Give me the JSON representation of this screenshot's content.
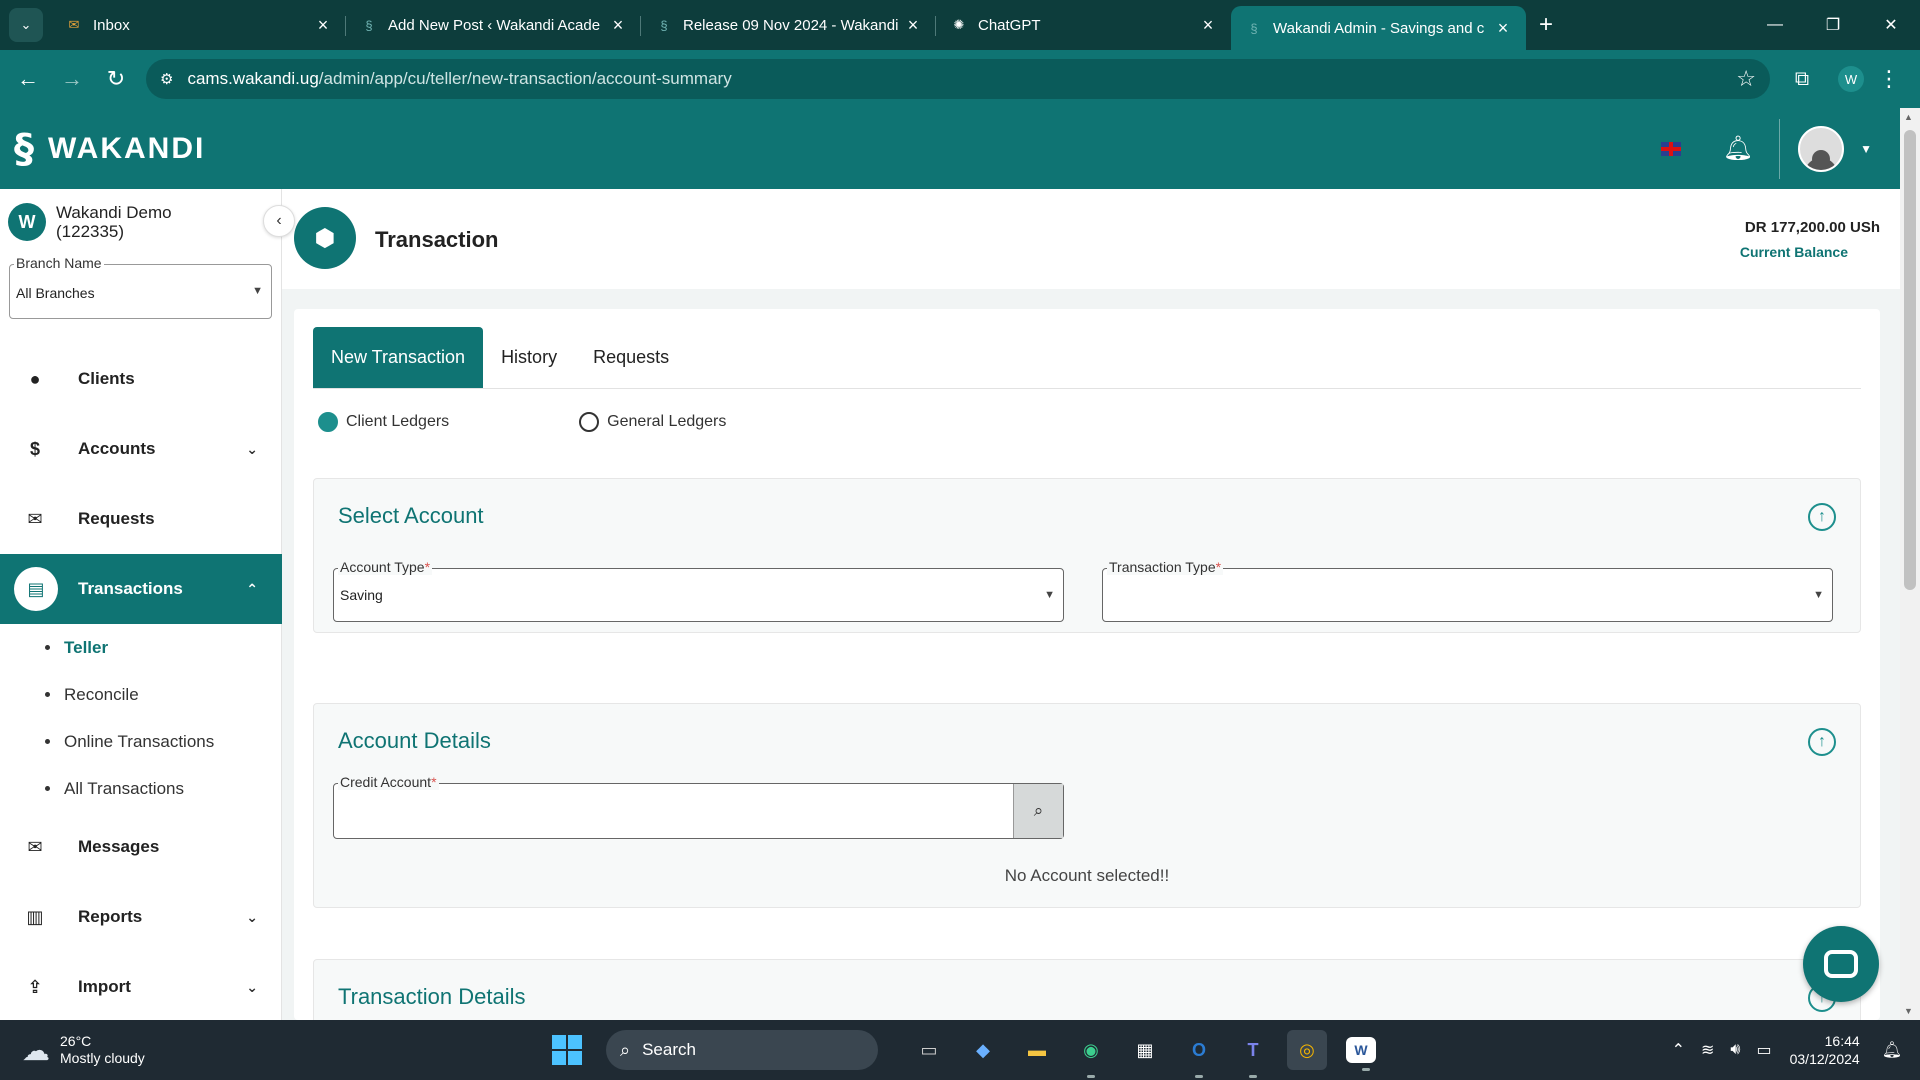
{
  "browser": {
    "tabs": [
      {
        "title": "Inbox",
        "icon": "mail-icon"
      },
      {
        "title": "Add New Post ‹ Wakandi Acade",
        "icon": "wakandi-icon"
      },
      {
        "title": "Release 09 Nov 2024 - Wakandi",
        "icon": "wakandi-icon"
      },
      {
        "title": "ChatGPT",
        "icon": "chatgpt-icon"
      },
      {
        "title": "Wakandi Admin - Savings and c",
        "icon": "wakandi-icon"
      }
    ],
    "url_domain": "cams.wakandi.ug",
    "url_path": "/admin/app/cu/teller/new-transaction/account-summary",
    "profile_initial": "W"
  },
  "header": {
    "logo_text": "WAKANDI"
  },
  "sidebar": {
    "org_initial": "W",
    "org_name": "Wakandi Demo",
    "org_id": "(122335)",
    "branch_label": "Branch Name",
    "branch_value": "All Branches",
    "menu": [
      {
        "label": "Clients",
        "icon": "person-icon"
      },
      {
        "label": "Accounts",
        "icon": "money-bag-icon"
      },
      {
        "label": "Requests",
        "icon": "envelope-icon"
      },
      {
        "label": "Transactions",
        "icon": "book-icon"
      },
      {
        "label": "Messages",
        "icon": "envelope-icon"
      },
      {
        "label": "Reports",
        "icon": "bar-chart-icon"
      },
      {
        "label": "Import",
        "icon": "upload-icon"
      }
    ],
    "submenu": [
      "Teller",
      "Reconcile",
      "Online Transactions",
      "All Transactions"
    ]
  },
  "page": {
    "title": "Transaction",
    "balance_amount": "DR 177,200.00  USh",
    "balance_label": "Current Balance"
  },
  "tabs": [
    "New Transaction",
    "History",
    "Requests"
  ],
  "ledger_options": [
    "Client Ledgers",
    "General Ledgers"
  ],
  "select_account": {
    "heading": "Select Account",
    "account_type_label": "Account Type",
    "account_type_value": "Saving",
    "transaction_type_label": "Transaction Type",
    "transaction_type_value": ""
  },
  "account_details": {
    "heading": "Account Details",
    "credit_account_label": "Credit Account",
    "empty_message": "No Account selected!!"
  },
  "transaction_details": {
    "heading": "Transaction Details"
  },
  "taskbar": {
    "temperature": "26°C",
    "weather": "Mostly cloudy",
    "search_label": "Search",
    "time": "16:44",
    "date": "03/12/2024"
  },
  "colors": {
    "brand_teal": "#0f7473",
    "dark_teal": "#0d3d3c",
    "required": "#d9534f"
  }
}
